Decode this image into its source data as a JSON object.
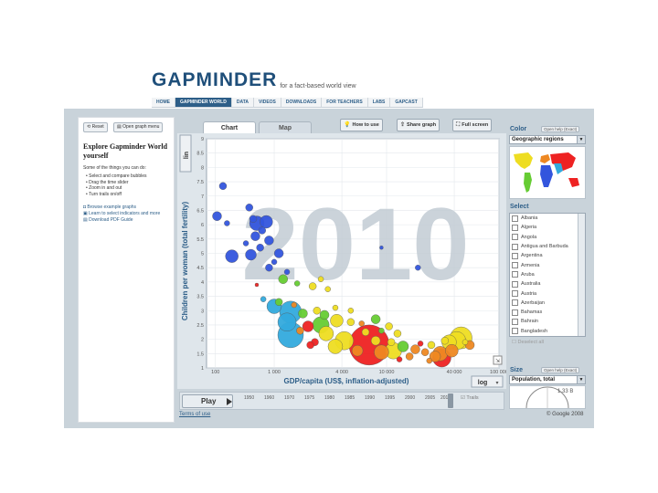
{
  "header": {
    "logo": "GAPMINDER",
    "tagline": "for a fact-based world view",
    "nav": [
      "HOME",
      "GAPMINDER WORLD",
      "DATA",
      "VIDEOS",
      "DOWNLOADS",
      "FOR TEACHERS",
      "LABS",
      "GAPCAST"
    ]
  },
  "left_panel": {
    "reset_label": "Reset",
    "open_menu_label": "Open graph menu",
    "title": "Explore Gapminder World yourself",
    "intro": "Some of the things you can do:",
    "tips": [
      "Select and compare bubbles",
      "Drag the time slider",
      "Zoom in and out",
      "Turn trails on/off"
    ],
    "links": [
      "Browse example graphs",
      "Learn to select indicators and more",
      "Download PDF Guide"
    ]
  },
  "toolbar": {
    "chart_tab": "Chart",
    "map_tab": "Map",
    "how_to_use": "How to use",
    "share_graph": "Share graph",
    "full_screen": "Full screen"
  },
  "colors": {
    "frame": "#c9d3da",
    "plot_bg": "#dfe6eb",
    "accent": "#2d5e88",
    "year_watermark": "#c3ccd4",
    "bubble_blue": "#3355dd",
    "bubble_cyan": "#33aadd",
    "bubble_green": "#66cc33",
    "bubble_yellow": "#eedd22",
    "bubble_orange": "#ee8822",
    "bubble_red": "#ee2222"
  },
  "chart_data": {
    "type": "scatter",
    "year": "2010",
    "ylabel": "Children per woman (total fertility)",
    "xlabel": "GDP/capita (US$, inflation-adjusted)",
    "y_scale_label": "lin",
    "x_scale_label": "log",
    "ylim": [
      1,
      9
    ],
    "xlim": [
      250,
      100000
    ],
    "y_ticks": [
      "9",
      "8.5",
      "8",
      "7.5",
      "7",
      "6.5",
      "6",
      "5.5",
      "5",
      "4.5",
      "4",
      "3.5",
      "3",
      "2.5",
      "2",
      "1.5",
      "1"
    ],
    "x_ticks": [
      {
        "label": "100",
        "v": 300
      },
      {
        "label": "1 000",
        "v": 1000
      },
      {
        "label": "4 000",
        "v": 4000
      },
      {
        "label": "10 000",
        "v": 10000
      },
      {
        "label": "40 000",
        "v": 40000
      },
      {
        "label": "100 000",
        "v": 100000
      }
    ],
    "bubbles": [
      {
        "x": 350,
        "y": 7.35,
        "r": 4,
        "c": "blue"
      },
      {
        "x": 310,
        "y": 6.3,
        "r": 5,
        "c": "blue"
      },
      {
        "x": 380,
        "y": 6.05,
        "r": 3,
        "c": "blue"
      },
      {
        "x": 600,
        "y": 6.6,
        "r": 4,
        "c": "blue"
      },
      {
        "x": 650,
        "y": 6.2,
        "r": 4,
        "c": "blue"
      },
      {
        "x": 700,
        "y": 6.05,
        "r": 8,
        "c": "blue"
      },
      {
        "x": 850,
        "y": 6.1,
        "r": 7,
        "c": "blue"
      },
      {
        "x": 780,
        "y": 5.8,
        "r": 4,
        "c": "blue"
      },
      {
        "x": 680,
        "y": 5.6,
        "r": 5,
        "c": "blue"
      },
      {
        "x": 900,
        "y": 5.45,
        "r": 5,
        "c": "blue"
      },
      {
        "x": 560,
        "y": 5.35,
        "r": 3,
        "c": "blue"
      },
      {
        "x": 750,
        "y": 5.2,
        "r": 4,
        "c": "blue"
      },
      {
        "x": 1100,
        "y": 5.0,
        "r": 5,
        "c": "blue"
      },
      {
        "x": 620,
        "y": 4.95,
        "r": 6,
        "c": "blue"
      },
      {
        "x": 420,
        "y": 4.9,
        "r": 7,
        "c": "blue"
      },
      {
        "x": 1000,
        "y": 4.7,
        "r": 3,
        "c": "blue"
      },
      {
        "x": 900,
        "y": 4.5,
        "r": 4,
        "c": "blue"
      },
      {
        "x": 1300,
        "y": 4.35,
        "r": 3,
        "c": "blue"
      },
      {
        "x": 9000,
        "y": 5.2,
        "r": 2,
        "c": "blue"
      },
      {
        "x": 19000,
        "y": 4.5,
        "r": 3,
        "c": "blue"
      },
      {
        "x": 1200,
        "y": 4.1,
        "r": 5,
        "c": "green"
      },
      {
        "x": 1600,
        "y": 3.95,
        "r": 3,
        "c": "green"
      },
      {
        "x": 2600,
        "y": 4.1,
        "r": 3,
        "c": "yellow"
      },
      {
        "x": 2200,
        "y": 3.85,
        "r": 4,
        "c": "yellow"
      },
      {
        "x": 3000,
        "y": 3.75,
        "r": 3,
        "c": "yellow"
      },
      {
        "x": 700,
        "y": 3.9,
        "r": 2,
        "c": "red"
      },
      {
        "x": 800,
        "y": 3.4,
        "r": 3,
        "c": "cyan"
      },
      {
        "x": 1100,
        "y": 3.3,
        "r": 4,
        "c": "green"
      },
      {
        "x": 1500,
        "y": 3.2,
        "r": 3,
        "c": "orange"
      },
      {
        "x": 1000,
        "y": 3.15,
        "r": 8,
        "c": "cyan"
      },
      {
        "x": 1400,
        "y": 2.95,
        "r": 12,
        "c": "cyan"
      },
      {
        "x": 1800,
        "y": 2.9,
        "r": 5,
        "c": "green"
      },
      {
        "x": 2400,
        "y": 3.0,
        "r": 4,
        "c": "yellow"
      },
      {
        "x": 2800,
        "y": 2.85,
        "r": 5,
        "c": "green"
      },
      {
        "x": 3500,
        "y": 3.1,
        "r": 3,
        "c": "yellow"
      },
      {
        "x": 4800,
        "y": 3.0,
        "r": 3,
        "c": "yellow"
      },
      {
        "x": 1300,
        "y": 2.6,
        "r": 10,
        "c": "cyan"
      },
      {
        "x": 2000,
        "y": 2.45,
        "r": 6,
        "c": "red"
      },
      {
        "x": 2600,
        "y": 2.5,
        "r": 9,
        "c": "green"
      },
      {
        "x": 3600,
        "y": 2.65,
        "r": 7,
        "c": "yellow"
      },
      {
        "x": 4800,
        "y": 2.6,
        "r": 4,
        "c": "yellow"
      },
      {
        "x": 6000,
        "y": 2.55,
        "r": 3,
        "c": "orange"
      },
      {
        "x": 8000,
        "y": 2.7,
        "r": 5,
        "c": "green"
      },
      {
        "x": 10500,
        "y": 2.45,
        "r": 4,
        "c": "yellow"
      },
      {
        "x": 1700,
        "y": 2.3,
        "r": 4,
        "c": "orange"
      },
      {
        "x": 2900,
        "y": 2.2,
        "r": 8,
        "c": "yellow"
      },
      {
        "x": 1400,
        "y": 2.15,
        "r": 14,
        "c": "cyan"
      },
      {
        "x": 6500,
        "y": 2.25,
        "r": 4,
        "c": "yellow"
      },
      {
        "x": 9000,
        "y": 2.3,
        "r": 3,
        "c": "green"
      },
      {
        "x": 12500,
        "y": 2.2,
        "r": 4,
        "c": "yellow"
      },
      {
        "x": 7000,
        "y": 1.8,
        "r": 22,
        "c": "red"
      },
      {
        "x": 4200,
        "y": 1.95,
        "r": 10,
        "c": "yellow"
      },
      {
        "x": 3500,
        "y": 1.75,
        "r": 8,
        "c": "yellow"
      },
      {
        "x": 5500,
        "y": 1.6,
        "r": 6,
        "c": "orange"
      },
      {
        "x": 9000,
        "y": 1.55,
        "r": 8,
        "c": "orange"
      },
      {
        "x": 14000,
        "y": 1.75,
        "r": 6,
        "c": "green"
      },
      {
        "x": 11000,
        "y": 1.9,
        "r": 4,
        "c": "yellow"
      },
      {
        "x": 2300,
        "y": 1.9,
        "r": 4,
        "c": "red"
      },
      {
        "x": 2100,
        "y": 1.8,
        "r": 4,
        "c": "red"
      },
      {
        "x": 8000,
        "y": 1.95,
        "r": 5,
        "c": "yellow"
      },
      {
        "x": 11500,
        "y": 1.6,
        "r": 9,
        "c": "yellow"
      },
      {
        "x": 18000,
        "y": 1.65,
        "r": 5,
        "c": "orange"
      },
      {
        "x": 22000,
        "y": 1.55,
        "r": 4,
        "c": "orange"
      },
      {
        "x": 30000,
        "y": 1.5,
        "r": 8,
        "c": "orange"
      },
      {
        "x": 36000,
        "y": 1.9,
        "r": 8,
        "c": "yellow"
      },
      {
        "x": 42000,
        "y": 1.95,
        "r": 10,
        "c": "yellow"
      },
      {
        "x": 46000,
        "y": 2.05,
        "r": 12,
        "c": "yellow"
      },
      {
        "x": 38000,
        "y": 1.6,
        "r": 7,
        "c": "orange"
      },
      {
        "x": 31000,
        "y": 1.35,
        "r": 10,
        "c": "red"
      },
      {
        "x": 25000,
        "y": 1.8,
        "r": 4,
        "c": "yellow"
      },
      {
        "x": 27000,
        "y": 1.4,
        "r": 6,
        "c": "orange"
      },
      {
        "x": 55000,
        "y": 1.8,
        "r": 5,
        "c": "orange"
      },
      {
        "x": 50000,
        "y": 1.9,
        "r": 3,
        "c": "yellow"
      },
      {
        "x": 33000,
        "y": 1.95,
        "r": 4,
        "c": "yellow"
      },
      {
        "x": 20000,
        "y": 1.85,
        "r": 3,
        "c": "red"
      },
      {
        "x": 16000,
        "y": 1.4,
        "r": 4,
        "c": "orange"
      },
      {
        "x": 24000,
        "y": 1.25,
        "r": 3,
        "c": "orange"
      },
      {
        "x": 13000,
        "y": 1.3,
        "r": 3,
        "c": "red"
      }
    ]
  },
  "timeline": {
    "play_label": "Play",
    "years": [
      "1950",
      "1960",
      "1970",
      "1975",
      "1980",
      "1985",
      "1990",
      "1995",
      "2000",
      "2005",
      "2010"
    ],
    "trails_label": "Trails"
  },
  "right_panel": {
    "color_label": "Color",
    "color_help": "Open help (Exact)",
    "color_value": "Geographic regions",
    "select_label": "Select",
    "countries": [
      "Albania",
      "Algeria",
      "Angola",
      "Antigua and Barbuda",
      "Argentina",
      "Armenia",
      "Aruba",
      "Australia",
      "Austria",
      "Azerbaijan",
      "Bahamas",
      "Bahrain",
      "Bangladesh"
    ],
    "deselect_all": "Deselect all",
    "size_label": "Size",
    "size_help": "Open help (Exact)",
    "size_value": "Population, total",
    "size_max": "1.33 B"
  },
  "footer": {
    "terms": "Terms of use",
    "copyright": "© Google 2008"
  }
}
